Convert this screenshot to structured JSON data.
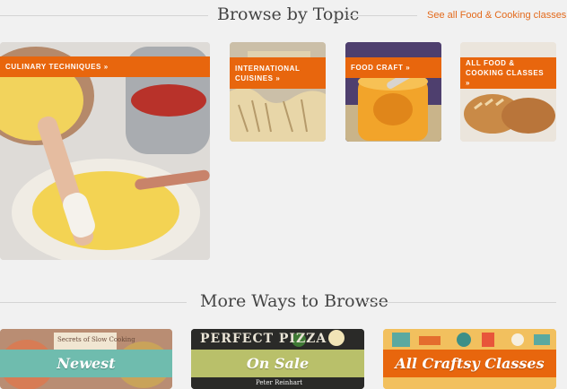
{
  "browse": {
    "title": "Browse by Topic",
    "see_all": "See all Food & Cooking classes »",
    "tiles": [
      {
        "label": "CULINARY TECHNIQUES »"
      },
      {
        "label": "INTERNATIONAL CUISINES »"
      },
      {
        "label": "FOOD CRAFT »"
      },
      {
        "label": "ALL FOOD & COOKING CLASSES »"
      }
    ]
  },
  "more": {
    "title": "More Ways to Browse",
    "cards": [
      {
        "label": "Newest",
        "cover_text": "Secrets of Slow Cooking",
        "color": "#6fbcae"
      },
      {
        "label": "On Sale",
        "cover_text": "PERFECT PIZZA",
        "author": "Peter Reinhart",
        "color": "#b9c06a"
      },
      {
        "label": "All Craftsy Classes",
        "color": "#e8660d"
      }
    ]
  },
  "colors": {
    "accent": "#e8660d",
    "background": "#f1f1f1",
    "divider": "#d4d4d4"
  }
}
